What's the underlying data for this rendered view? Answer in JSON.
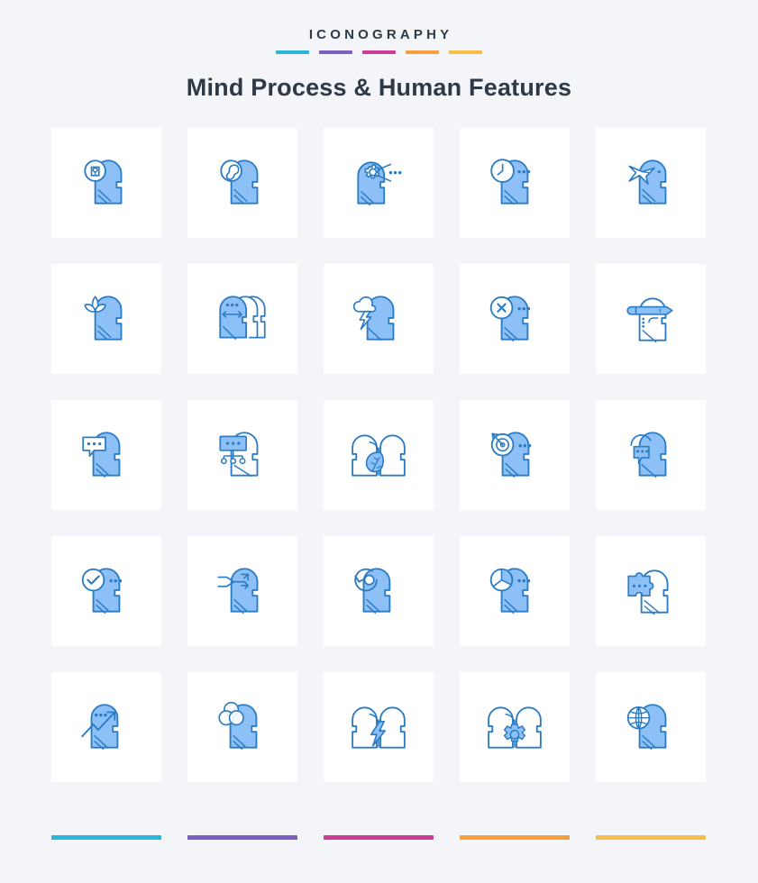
{
  "header": {
    "brand": "ICONOGRAPHY",
    "title": "Mind Process & Human Features"
  },
  "palette": {
    "cyan": "#29b6d8",
    "purple": "#7b5fc0",
    "magenta": "#cc3a95",
    "orange": "#f4a03f",
    "gold": "#f5be4a",
    "icon_fill": "#8cc0f7",
    "icon_stroke": "#2b7cc4",
    "card_bg": "#ffffff",
    "page_bg": "#f4f5f9",
    "text": "#2d3a45"
  },
  "brand_rules": [
    {
      "name": "rule-cyan",
      "color": "#29b6d8"
    },
    {
      "name": "rule-purple",
      "color": "#7b5fc0"
    },
    {
      "name": "rule-magenta",
      "color": "#cc3a95"
    },
    {
      "name": "rule-orange",
      "color": "#f4a03f"
    },
    {
      "name": "rule-gold",
      "color": "#f5be4a"
    }
  ],
  "footer_rules": [
    {
      "name": "footer-rule-cyan",
      "color": "#29b6d8"
    },
    {
      "name": "footer-rule-purple",
      "color": "#7b5fc0"
    },
    {
      "name": "footer-rule-magenta",
      "color": "#cc3a95"
    },
    {
      "name": "footer-rule-orange",
      "color": "#f4a03f"
    },
    {
      "name": "footer-rule-gold",
      "color": "#f5be4a"
    }
  ],
  "grid": {
    "columns": 5,
    "rows": 5,
    "count": 25,
    "icons": [
      {
        "id": 1,
        "name": "head-keyhole-icon",
        "label": "Mind Security"
      },
      {
        "id": 2,
        "name": "head-wrench-icon",
        "label": "Mind Repair"
      },
      {
        "id": 3,
        "name": "head-gear-broadcast-icon",
        "label": "Process Broadcast"
      },
      {
        "id": 4,
        "name": "head-clock-icon",
        "label": "Time Thinking"
      },
      {
        "id": 5,
        "name": "head-origami-bird-icon",
        "label": "Creative Freedom"
      },
      {
        "id": 6,
        "name": "head-lotus-icon",
        "label": "Mindfulness"
      },
      {
        "id": 7,
        "name": "heads-exchange-icon",
        "label": "Idea Exchange"
      },
      {
        "id": 8,
        "name": "head-brainstorm-icon",
        "label": "Brainstorm"
      },
      {
        "id": 9,
        "name": "head-cross-icon",
        "label": "Rejected Thought"
      },
      {
        "id": 10,
        "name": "head-pencil-icon",
        "label": "Creative Writing"
      },
      {
        "id": 11,
        "name": "head-chat-bubble-icon",
        "label": "Communication"
      },
      {
        "id": 12,
        "name": "head-network-icon",
        "label": "Mind Mapping"
      },
      {
        "id": 13,
        "name": "heads-leaf-icon",
        "label": "Shared Growth"
      },
      {
        "id": 14,
        "name": "head-target-icon",
        "label": "Focus Target"
      },
      {
        "id": 15,
        "name": "head-thought-bubble-icon",
        "label": "Thinking"
      },
      {
        "id": 16,
        "name": "head-check-icon",
        "label": "Approved Idea"
      },
      {
        "id": 17,
        "name": "head-arrows-merge-icon",
        "label": "Decision Flow"
      },
      {
        "id": 18,
        "name": "head-refresh-icon",
        "label": "Rethinking"
      },
      {
        "id": 19,
        "name": "head-pie-chart-icon",
        "label": "Analysis"
      },
      {
        "id": 20,
        "name": "head-puzzle-icon",
        "label": "Problem Solving"
      },
      {
        "id": 21,
        "name": "head-growth-chart-icon",
        "label": "Mind Growth"
      },
      {
        "id": 22,
        "name": "head-venn-icon",
        "label": "Connected Ideas"
      },
      {
        "id": 23,
        "name": "heads-lightning-icon",
        "label": "Shared Energy"
      },
      {
        "id": 24,
        "name": "heads-gear-icon",
        "label": "Shared Process"
      },
      {
        "id": 25,
        "name": "head-globe-icon",
        "label": "Global Mind"
      }
    ]
  }
}
